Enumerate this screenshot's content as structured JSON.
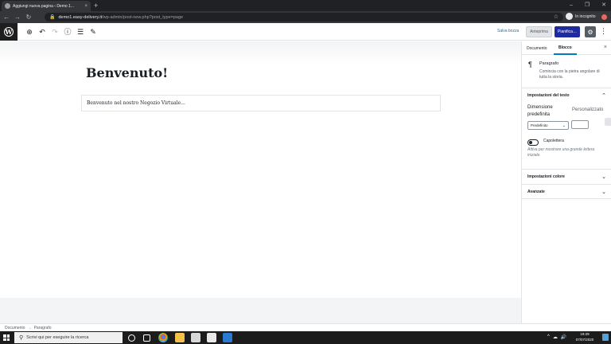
{
  "browser": {
    "tab_title": "Aggiungi nuova pagina ‹ Demo 1...",
    "tab_close": "×",
    "new_tab": "+",
    "window_controls": [
      "–",
      "❐",
      "✕"
    ],
    "nav": {
      "back": "←",
      "forward": "→",
      "reload": "↻"
    },
    "url_host": "demo1.easy-delivery.it",
    "url_path": "/wp-admin/post-new.php?post_type=page",
    "incognito_label": "In incognito"
  },
  "editor_header": {
    "logo": "W",
    "tools": [
      "⊕",
      "↶",
      "↷",
      "ⓘ",
      "☰",
      "✎"
    ],
    "save_draft": "Salva bozza",
    "preview": "Anteprima",
    "schedule": "Pianifica…",
    "settings_icon": "⚙",
    "more_icon": "⋮"
  },
  "content": {
    "title": "Benvenuto!",
    "paragraph": "Benvenuto nel nostro Negozio Virtuale..."
  },
  "sidebar": {
    "tabs": [
      "Documento",
      "Blocco"
    ],
    "active_tab": "Blocco",
    "close": "×",
    "block": {
      "icon": "¶",
      "name": "Paragrafo",
      "description": "Comincia con la pietra angolare di tutta la storia."
    },
    "text_settings": {
      "title": "Impostazioni del testo",
      "font_size_label": "Dimensione predefinita",
      "custom_label": "Personalizzato",
      "font_size_value": "Predefinito",
      "drop_cap_label": "Capolettera",
      "drop_cap_enabled": false,
      "drop_cap_help": "Attiva per mostrare una grande lettera iniziale."
    },
    "color_settings": {
      "title": "Impostazioni colore"
    },
    "advanced": {
      "title": "Avanzate"
    }
  },
  "breadcrumb": {
    "root": "Documento",
    "separator": "→",
    "current": "Paragrafo"
  },
  "taskbar": {
    "search_placeholder": "Scrivi qui per eseguire la ricerca",
    "clock_time": "19:29",
    "clock_date": "07/07/2020",
    "tray_icons": [
      "^",
      "☁",
      "🔊"
    ]
  }
}
